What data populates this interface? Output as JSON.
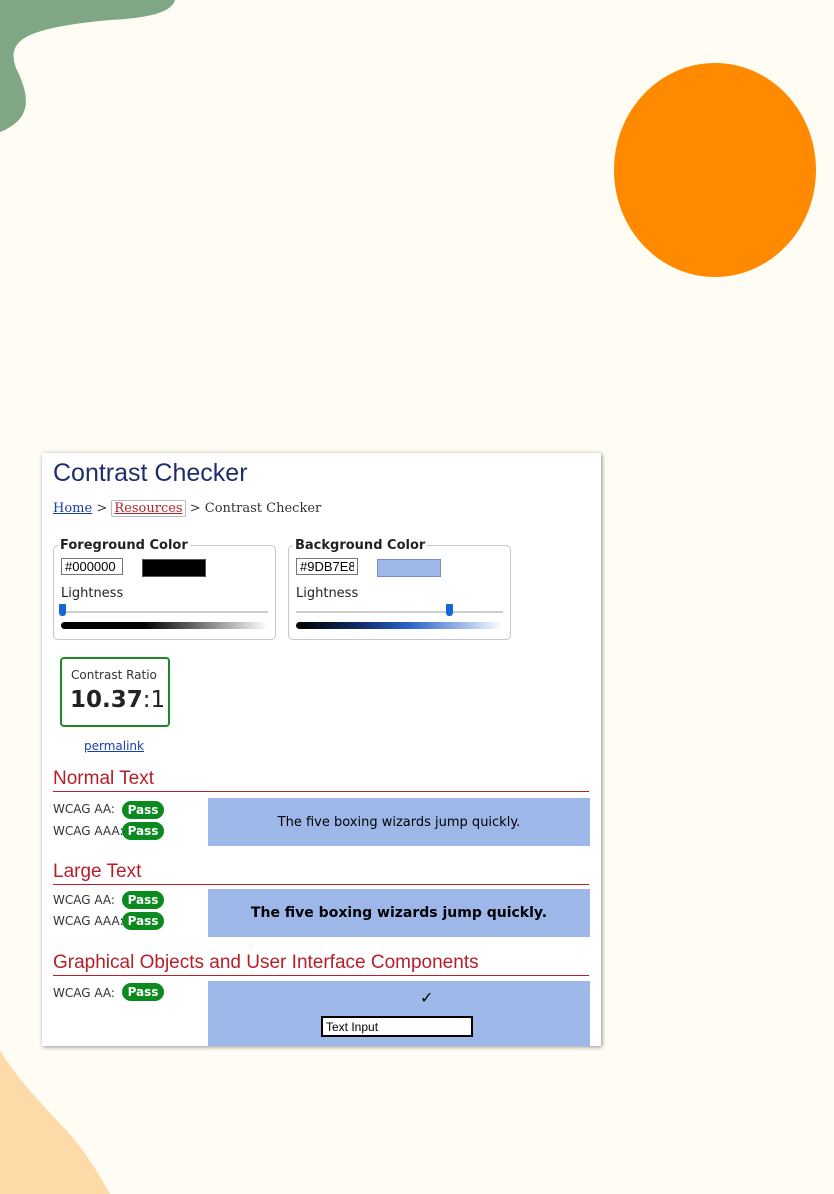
{
  "page": {
    "title": "Contrast Checker",
    "breadcrumb": {
      "home": "Home",
      "separator": ">",
      "resources": "Resources",
      "current": "Contrast Checker"
    }
  },
  "foreground": {
    "legend": "Foreground Color",
    "hex": "#000000",
    "lightness_label": "Lightness",
    "lightness_value": 0
  },
  "background": {
    "legend": "Background Color",
    "hex": "#9DB7E8",
    "lightness_label": "Lightness",
    "lightness_value": 0.76
  },
  "ratio": {
    "label": "Contrast Ratio",
    "value": "10.37",
    "suffix": ":1",
    "permalink": "permalink"
  },
  "normal_text": {
    "heading": "Normal Text",
    "aa_label": "WCAG AA:",
    "aa_result": "Pass",
    "aaa_label": "WCAG AAA:",
    "aaa_result": "Pass",
    "sample": "The five boxing wizards jump quickly."
  },
  "large_text": {
    "heading": "Large Text",
    "aa_label": "WCAG AA:",
    "aa_result": "Pass",
    "aaa_label": "WCAG AAA:",
    "aaa_result": "Pass",
    "sample": "The five boxing wizards jump quickly."
  },
  "graphics": {
    "heading": "Graphical Objects and User Interface Components",
    "aa_label": "WCAG AA:",
    "aa_result": "Pass",
    "checkmark": "✓",
    "input_value": "Text Input"
  },
  "colors": {
    "page_bg": "#FFFDF3",
    "green_blob": "#7FA786",
    "orange_circle": "#FF8A00",
    "peach_shape": "#FDDBA9",
    "accent_red": "#B51F2A",
    "pass_green": "#0A8A1F",
    "title_navy": "#1F2E6B"
  }
}
